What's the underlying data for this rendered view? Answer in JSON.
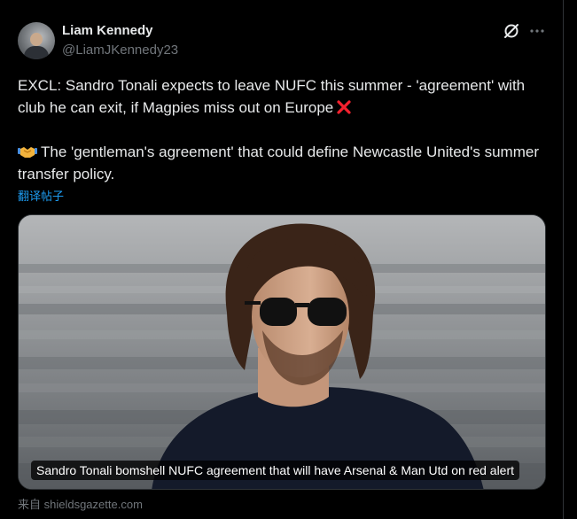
{
  "author": {
    "display_name": "Liam Kennedy",
    "handle": "@LiamJKennedy23"
  },
  "header_icons": {
    "grok": "grok-icon",
    "more": "more-horizontal-icon"
  },
  "tweet": {
    "line1": "EXCL: Sandro Tonali expects to leave NUFC this summer - 'agreement' with club he can exit, if Magpies miss out on Europe",
    "line1_emoji": "cross-mark-emoji",
    "line2": "The 'gentleman's agreement' that could define Newcastle United's summer transfer policy.",
    "line2_emoji": "handshake-emoji",
    "translate_label": "翻译帖子"
  },
  "media": {
    "caption": "Sandro Tonali bomshell NUFC agreement that will have Arsenal & Man Utd on red alert",
    "source": "来自 shieldsgazette.com"
  },
  "colors": {
    "background": "#000000",
    "text": "#e7e9ea",
    "muted": "#71767b",
    "link": "#1d9bf0",
    "cross": "#f4212e"
  }
}
